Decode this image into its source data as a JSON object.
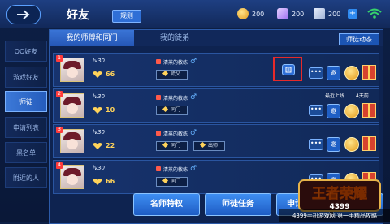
{
  "header": {
    "title": "好友",
    "rules_label": "规则",
    "currency": [
      {
        "name": "gold-coin",
        "value": "200",
        "color": "#f2b73a"
      },
      {
        "name": "diamond",
        "value": "200",
        "color": "#c9a3ff"
      },
      {
        "name": "voucher",
        "value": "200",
        "color": "#b9c9e6"
      }
    ]
  },
  "sidebar": {
    "items": [
      {
        "label": "QQ好友",
        "active": false
      },
      {
        "label": "游戏好友",
        "active": false
      },
      {
        "label": "师徒",
        "active": true
      },
      {
        "label": "申请列表",
        "active": false
      },
      {
        "label": "黑名单",
        "active": false
      },
      {
        "label": "附近的人",
        "active": false
      }
    ]
  },
  "tabs": [
    {
      "label": "我的师傅和同门",
      "active": true
    },
    {
      "label": "我的徒弟",
      "active": false
    }
  ],
  "news_label": "师徒动态",
  "rows": [
    {
      "rank": "1",
      "level": "lv30",
      "score": "66",
      "name": "清蒸的教练",
      "tags": [
        "师父"
      ],
      "online": "",
      "online_days": ""
    },
    {
      "rank": "2",
      "level": "lv30",
      "score": "10",
      "name": "清蒸的教练",
      "tags": [
        "同门"
      ],
      "online": "最近上线",
      "online_days": "4天前"
    },
    {
      "rank": "3",
      "level": "lv30",
      "score": "22",
      "name": "清蒸的教练",
      "tags": [
        "同门",
        "出师"
      ],
      "online": "",
      "online_days": ""
    },
    {
      "rank": "4",
      "level": "lv30",
      "score": "66",
      "name": "清蒸的教练",
      "tags": [
        "同门"
      ],
      "online": "",
      "online_days": ""
    }
  ],
  "bottom_buttons": [
    "名师特权",
    "师徒任务",
    "申请列表",
    "拜师"
  ],
  "logo_text": "王者荣耀",
  "logo_sub": "4399",
  "watermark": "4399手机游戏网 第一手精品攻略"
}
